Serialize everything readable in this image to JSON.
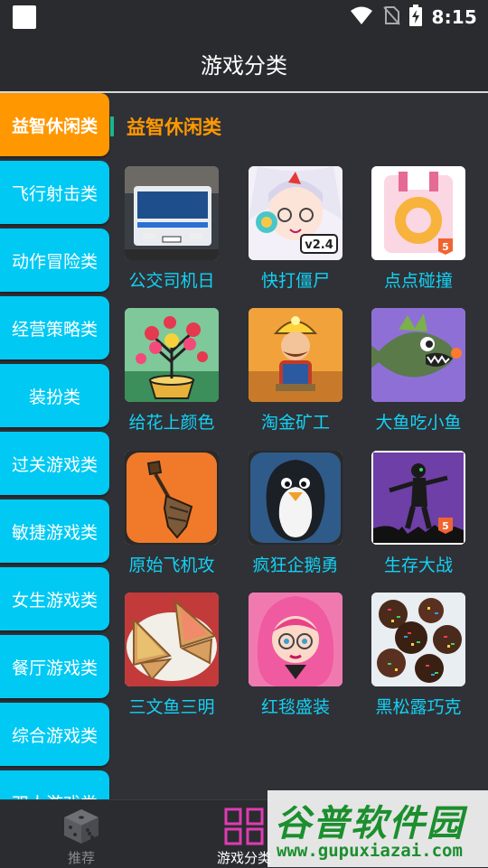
{
  "status_bar": {
    "time": "8:15"
  },
  "header": {
    "title": "游戏分类"
  },
  "sidebar": {
    "items": [
      {
        "label": "益智休闲类",
        "active": true
      },
      {
        "label": "飞行射击类"
      },
      {
        "label": "动作冒险类"
      },
      {
        "label": "经营策略类"
      },
      {
        "label": "装扮类"
      },
      {
        "label": "过关游戏类"
      },
      {
        "label": "敏捷游戏类"
      },
      {
        "label": "女生游戏类"
      },
      {
        "label": "餐厅游戏类"
      },
      {
        "label": "综合游戏类"
      },
      {
        "label": "双人游戏类"
      }
    ]
  },
  "content": {
    "section_title": "益智休闲类",
    "games": [
      {
        "name": "公交司机日",
        "icon": "bus-thumbnail"
      },
      {
        "name": "快打僵尸",
        "icon": "anime-girl-thumbnail",
        "badge": "v2.4"
      },
      {
        "name": "点点碰撞",
        "icon": "pink-ring-thumbnail",
        "badge": "5"
      },
      {
        "name": "给花上颜色",
        "icon": "flower-pot-thumbnail"
      },
      {
        "name": "淘金矿工",
        "icon": "gold-miner-thumbnail"
      },
      {
        "name": "大鱼吃小鱼",
        "icon": "big-fish-thumbnail"
      },
      {
        "name": "原始飞机攻",
        "icon": "primitive-plane-thumbnail"
      },
      {
        "name": "疯狂企鹅勇",
        "icon": "penguin-thumbnail"
      },
      {
        "name": "生存大战",
        "icon": "zombie-silhouette-thumbnail",
        "badge": "5"
      },
      {
        "name": "三文鱼三明",
        "icon": "sandwich-thumbnail"
      },
      {
        "name": "红毯盛装",
        "icon": "pink-hair-girl-thumbnail"
      },
      {
        "name": "黑松露巧克",
        "icon": "chocolate-truffle-thumbnail"
      }
    ]
  },
  "bottom_nav": {
    "recommend_label": "推荐",
    "category_label": "游戏分类"
  },
  "watermark": {
    "brand": "谷普软件园",
    "url": "www.gupuxiazai.com"
  },
  "colors": {
    "background": "#2f3136",
    "sidebar_item": "#00c9f3",
    "sidebar_active": "#ff9800",
    "game_name": "#13d1f5",
    "section_title": "#ff9800",
    "category_icon": "#e03bb3"
  }
}
